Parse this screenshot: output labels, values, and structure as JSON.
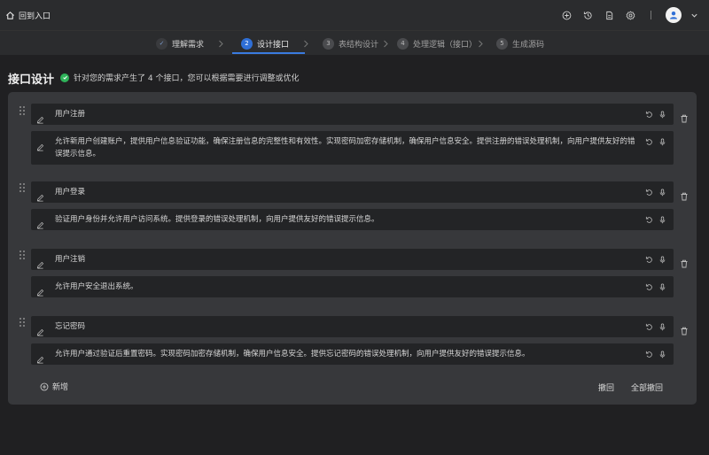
{
  "topbar": {
    "back_label": "回到入口",
    "icons": [
      "add-circle-icon",
      "history-icon",
      "document-icon",
      "settings-icon"
    ]
  },
  "stepper": {
    "steps": [
      {
        "num": "✓",
        "label": "理解需求",
        "state": "done"
      },
      {
        "num": "2",
        "label": "设计接口",
        "state": "active"
      },
      {
        "num": "3",
        "label": "表结构设计",
        "state": "todo"
      },
      {
        "num": "4",
        "label": "处理逻辑（接口）",
        "state": "todo"
      },
      {
        "num": "5",
        "label": "生成源码",
        "state": "todo"
      }
    ]
  },
  "header": {
    "title": "接口设计",
    "notice": "针对您的需求产生了 4 个接口，您可以根据需要进行调整或优化"
  },
  "interfaces": [
    {
      "name": "用户注册",
      "desc_line1": "允许新用户创建账户，提供用户信息验证功能，确保注册信息的完整性和有效性。实现密码加密存储机制，确保用户信息安全。提供注册的错误处理机制，向用户提供友好的错",
      "desc_line2": "误提示信息。"
    },
    {
      "name": "用户登录",
      "desc_line1": "验证用户身份并允许用户访问系统。提供登录的错误处理机制，向用户提供友好的错误提示信息。",
      "desc_line2": ""
    },
    {
      "name": "用户注销",
      "desc_line1": "允许用户安全退出系统。",
      "desc_line2": ""
    },
    {
      "name": "忘记密码",
      "desc_line1": "允许用户通过验证后重置密码。实现密码加密存储机制，确保用户信息安全。提供忘记密码的错误处理机制，向用户提供友好的错误提示信息。",
      "desc_line2": ""
    }
  ],
  "footer": {
    "add_label": "新增",
    "undo_label": "撤回",
    "undo_all_label": "全部撤回"
  },
  "colors": {
    "accent": "#2f6fd6",
    "success": "#2fb35a",
    "panel": "#37383b",
    "field": "#232426"
  }
}
